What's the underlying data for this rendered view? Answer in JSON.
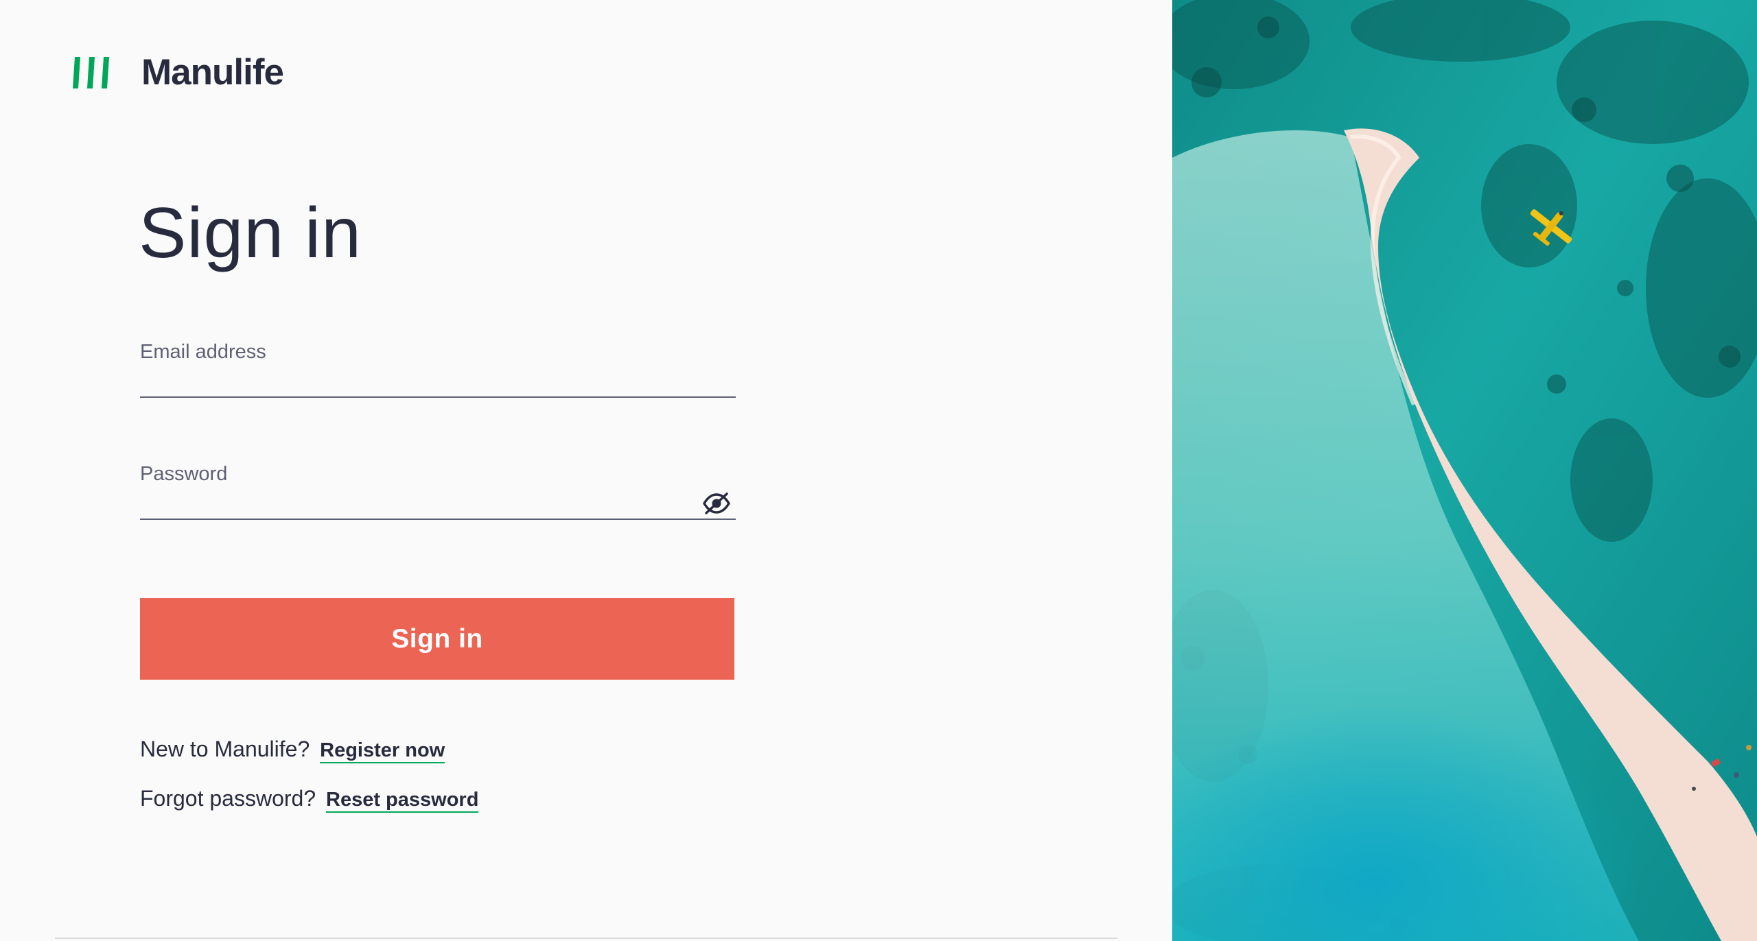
{
  "brand": {
    "name": "Manulife",
    "mark_icon": "manulife-stripes-icon",
    "mark_color": "#00a758"
  },
  "form": {
    "title": "Sign in",
    "email": {
      "label": "Email address",
      "value": "",
      "placeholder": ""
    },
    "password": {
      "label": "Password",
      "value": "",
      "placeholder": "",
      "toggle_icon": "eye-slash-icon"
    },
    "submit_label": "Sign in",
    "submit_color": "#ec6453"
  },
  "links": {
    "register_prompt": "New to Manulife?",
    "register_label": "Register now",
    "reset_prompt": "Forgot password?",
    "reset_label": "Reset password",
    "underline_color": "#00a758"
  },
  "hero": {
    "description_icon": "aerial-beach-photo"
  }
}
